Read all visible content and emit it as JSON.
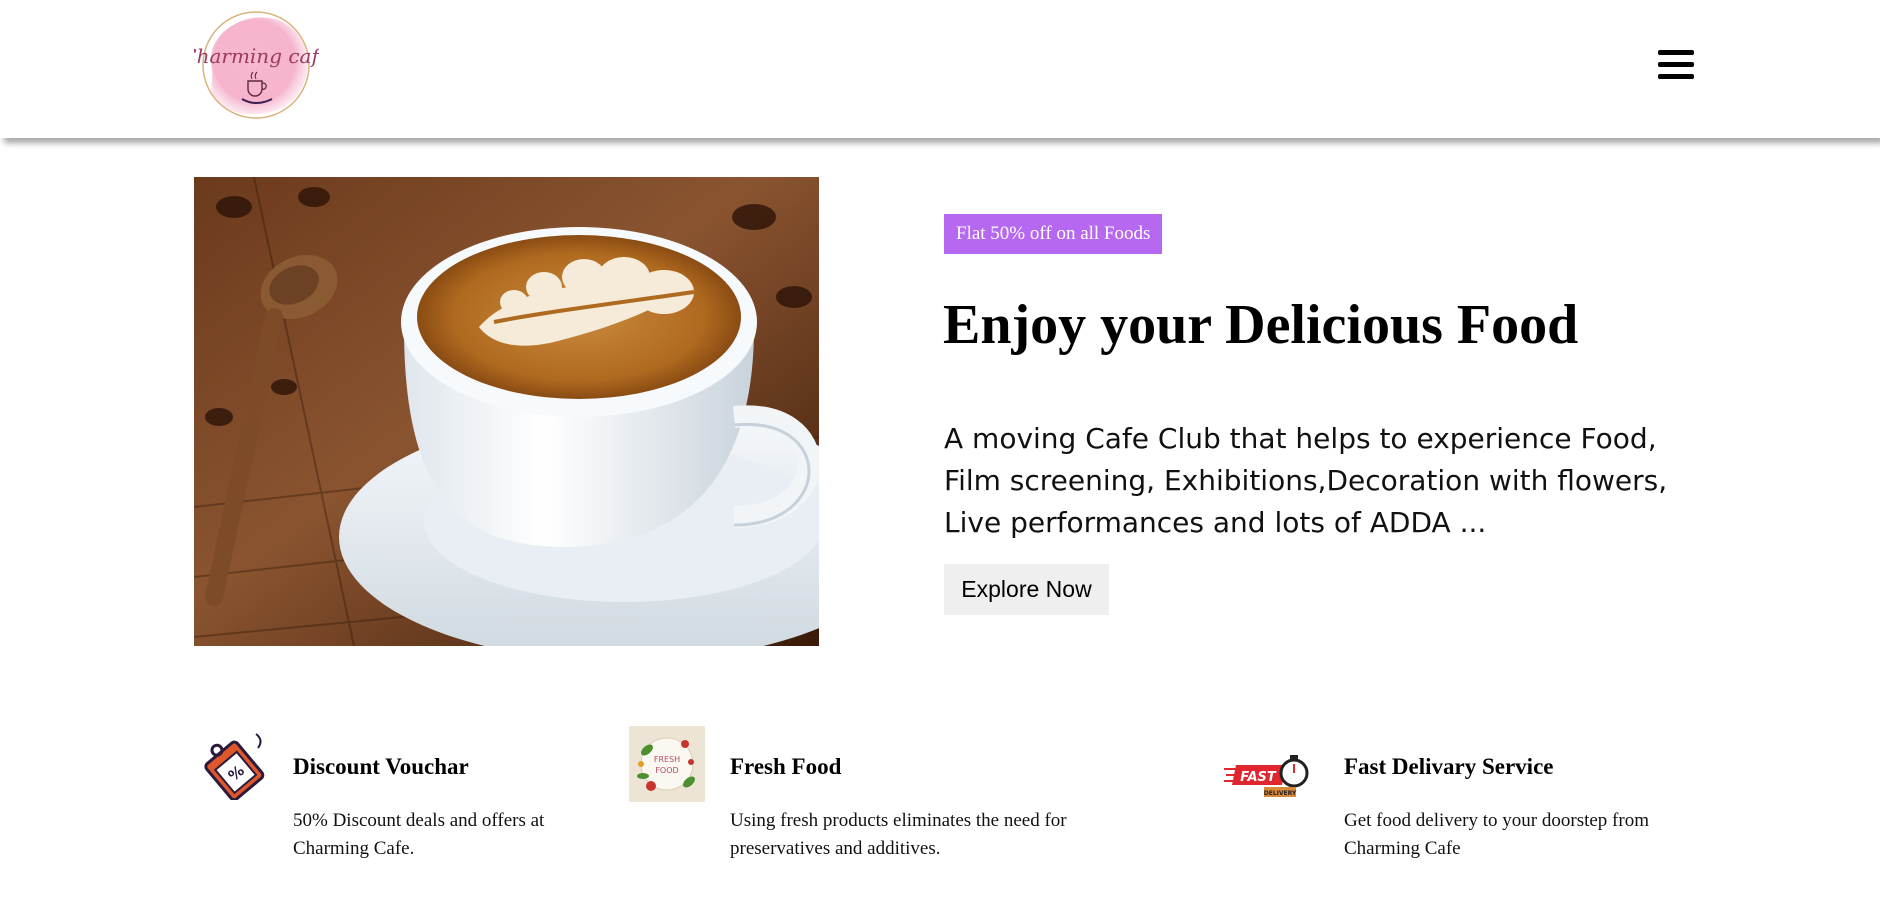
{
  "header": {
    "logo_text": "Charming cafe",
    "menu_icon": "hamburger-menu-icon"
  },
  "hero": {
    "image_icon": "latte-art-coffee-cup",
    "badge": "Flat 50% off on all Foods",
    "title": "Enjoy your Delicious Food",
    "description": "A moving Cafe Club that helps to experience Food, Film screening, Exhibitions,Decoration with flowers, Live performances and lots of ADDA ...",
    "cta_label": "Explore Now"
  },
  "features": [
    {
      "icon": "discount-tag-icon",
      "title": "Discount Vouchar",
      "text": "50% Discount deals and offers at Charming Cafe."
    },
    {
      "icon": "fresh-food-icon",
      "icon_text": "FRESH FOOD",
      "title": "Fresh Food",
      "text": "Using fresh products eliminates the need for preservatives and additives."
    },
    {
      "icon": "fast-delivery-icon",
      "icon_text": "FAST",
      "icon_subtext": "DELIVERY",
      "title": "Fast Delivary Service",
      "text": "Get food delivery to your doorstep from Charming Cafe"
    }
  ],
  "colors": {
    "badge": "#b668f0",
    "button_bg": "#efefef",
    "logo_pink": "#f4a6c4"
  }
}
